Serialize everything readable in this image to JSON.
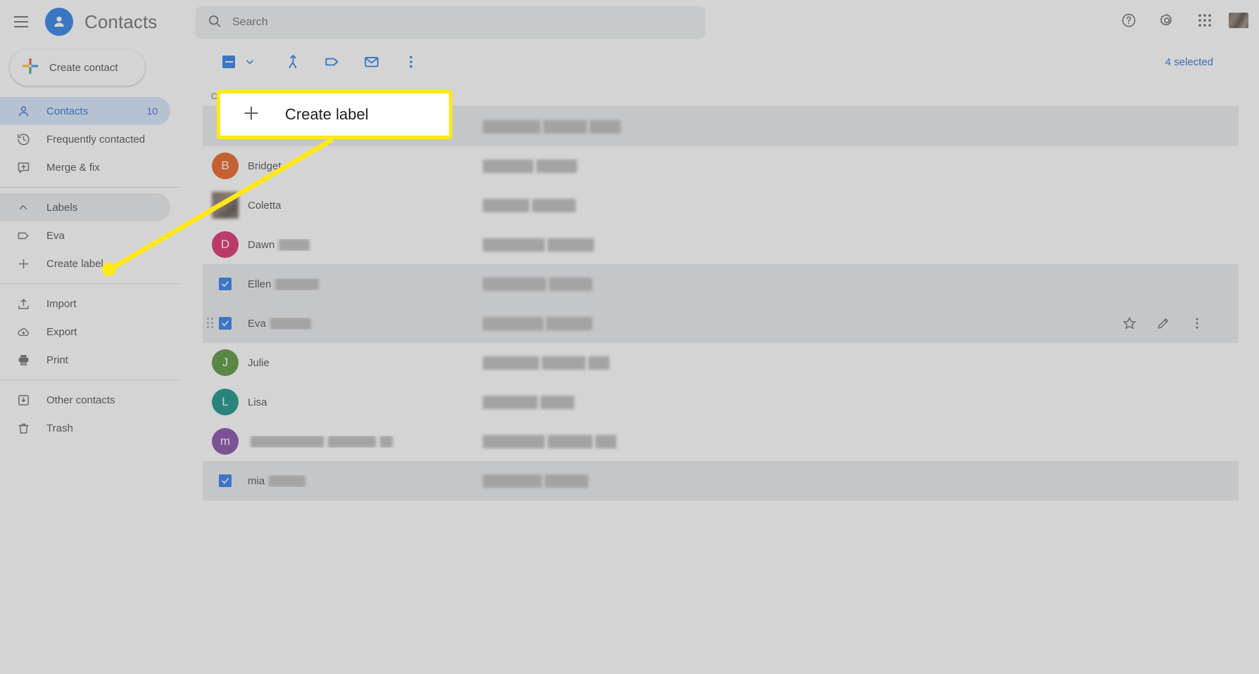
{
  "header": {
    "menu_icon": "hamburger-menu-icon",
    "logo_icon": "contacts-person-icon",
    "title": "Contacts",
    "search": {
      "icon": "search-icon",
      "placeholder": "Search",
      "value": ""
    },
    "right_icons": [
      {
        "name": "help-icon",
        "label": "Help"
      },
      {
        "name": "gear-icon",
        "label": "Settings"
      },
      {
        "name": "apps-grid-icon",
        "label": "Google apps"
      },
      {
        "name": "avatar",
        "label": "Google Account"
      }
    ]
  },
  "sidebar": {
    "create_contact": {
      "label": "Create contact",
      "icon": "plus-multicolor-icon"
    },
    "items": [
      {
        "label": "Contacts",
        "icon": "person-icon",
        "count": "10",
        "active": true
      },
      {
        "label": "Frequently contacted",
        "icon": "history-clock-icon",
        "count": "",
        "active": false
      },
      {
        "label": "Merge & fix",
        "icon": "merge-fix-icon",
        "count": "",
        "active": false
      }
    ],
    "labels_section": {
      "header": {
        "label": "Labels",
        "icon": "chevron-up-icon"
      },
      "items": [
        {
          "label": "Eva",
          "icon": "label-tag-icon"
        },
        {
          "label": "Create label",
          "icon": "plus-icon"
        }
      ]
    },
    "tools": [
      {
        "label": "Import",
        "icon": "import-upload-icon"
      },
      {
        "label": "Export",
        "icon": "export-download-icon"
      },
      {
        "label": "Print",
        "icon": "printer-icon"
      }
    ],
    "footer": [
      {
        "label": "Other contacts",
        "icon": "other-contacts-icon"
      },
      {
        "label": "Trash",
        "icon": "trash-icon"
      }
    ]
  },
  "toolbar": {
    "select_all_state": "indeterminate",
    "select_all_icon": "checkbox-indeterminate-icon",
    "caret_icon": "chevron-down-icon",
    "actions": [
      {
        "name": "merge-contacts-icon",
        "label": "Merge"
      },
      {
        "name": "manage-labels-icon",
        "label": "Manage labels"
      },
      {
        "name": "send-email-icon",
        "label": "Send email"
      },
      {
        "name": "more-options-icon",
        "label": "More actions"
      }
    ],
    "selected_count": "4 selected"
  },
  "list": {
    "header_text": "C",
    "row_actions": [
      {
        "name": "star-icon",
        "label": "Add to favorites"
      },
      {
        "name": "edit-pencil-icon",
        "label": "Edit contact"
      },
      {
        "name": "more-options-icon",
        "label": "More actions"
      }
    ],
    "rows": [
      {
        "name": "",
        "name_redacted_widths": [
          86,
          62,
          48
        ],
        "avatar_letter": "",
        "avatar_color": "#ffffff",
        "selected": true,
        "hidden_name": true,
        "email_redacted_widths": [
          82,
          62,
          44
        ],
        "show_drag": false,
        "show_actions": false
      },
      {
        "name": "Bridget",
        "name_redacted_widths": [],
        "avatar_letter": "B",
        "avatar_color": "#e8530e",
        "selected": false,
        "email_redacted_widths": [
          72,
          58
        ],
        "show_drag": false,
        "show_actions": false
      },
      {
        "name": "Coletta",
        "name_redacted_widths": [],
        "avatar_letter": "",
        "avatar_color": "photo",
        "selected": false,
        "email_redacted_widths": [
          66,
          62
        ],
        "show_drag": false,
        "show_actions": false
      },
      {
        "name": "Dawn",
        "name_redacted_widths": [
          44
        ],
        "avatar_letter": "D",
        "avatar_color": "#d81b60",
        "selected": false,
        "email_redacted_widths": [
          88,
          66
        ],
        "show_drag": false,
        "show_actions": false
      },
      {
        "name": "Ellen",
        "name_redacted_widths": [
          62
        ],
        "avatar_letter": "",
        "avatar_color": "#1a73e8",
        "selected": true,
        "email_redacted_widths": [
          90,
          62
        ],
        "show_drag": false,
        "show_actions": false
      },
      {
        "name": "Eva",
        "name_redacted_widths": [
          58
        ],
        "avatar_letter": "",
        "avatar_color": "#1a73e8",
        "selected": true,
        "email_redacted_widths": [
          86,
          66
        ],
        "show_drag": true,
        "show_actions": true
      },
      {
        "name": "Julie",
        "name_redacted_widths": [],
        "avatar_letter": "J",
        "avatar_color": "#4a8b2c",
        "selected": false,
        "email_redacted_widths": [
          80,
          62,
          30
        ],
        "show_drag": false,
        "show_actions": false
      },
      {
        "name": "Lisa",
        "name_redacted_widths": [],
        "avatar_letter": "L",
        "avatar_color": "#00897b",
        "selected": false,
        "email_redacted_widths": [
          78,
          48
        ],
        "show_drag": false,
        "show_actions": false
      },
      {
        "name": "",
        "name_redacted_widths": [
          104,
          68,
          18
        ],
        "avatar_letter": "m",
        "avatar_color": "#7b3fa0",
        "selected": false,
        "hidden_name": true,
        "email_redacted_widths": [
          88,
          64,
          30
        ],
        "show_drag": false,
        "show_actions": false
      },
      {
        "name": "mia",
        "name_redacted_widths": [
          52
        ],
        "avatar_letter": "",
        "avatar_color": "#1a73e8",
        "selected": true,
        "email_redacted_widths": [
          84,
          62
        ],
        "show_drag": false,
        "show_actions": false
      }
    ]
  },
  "callout": {
    "label": "Create label",
    "icon": "plus-icon",
    "highlight_color": "#ffe81a"
  }
}
